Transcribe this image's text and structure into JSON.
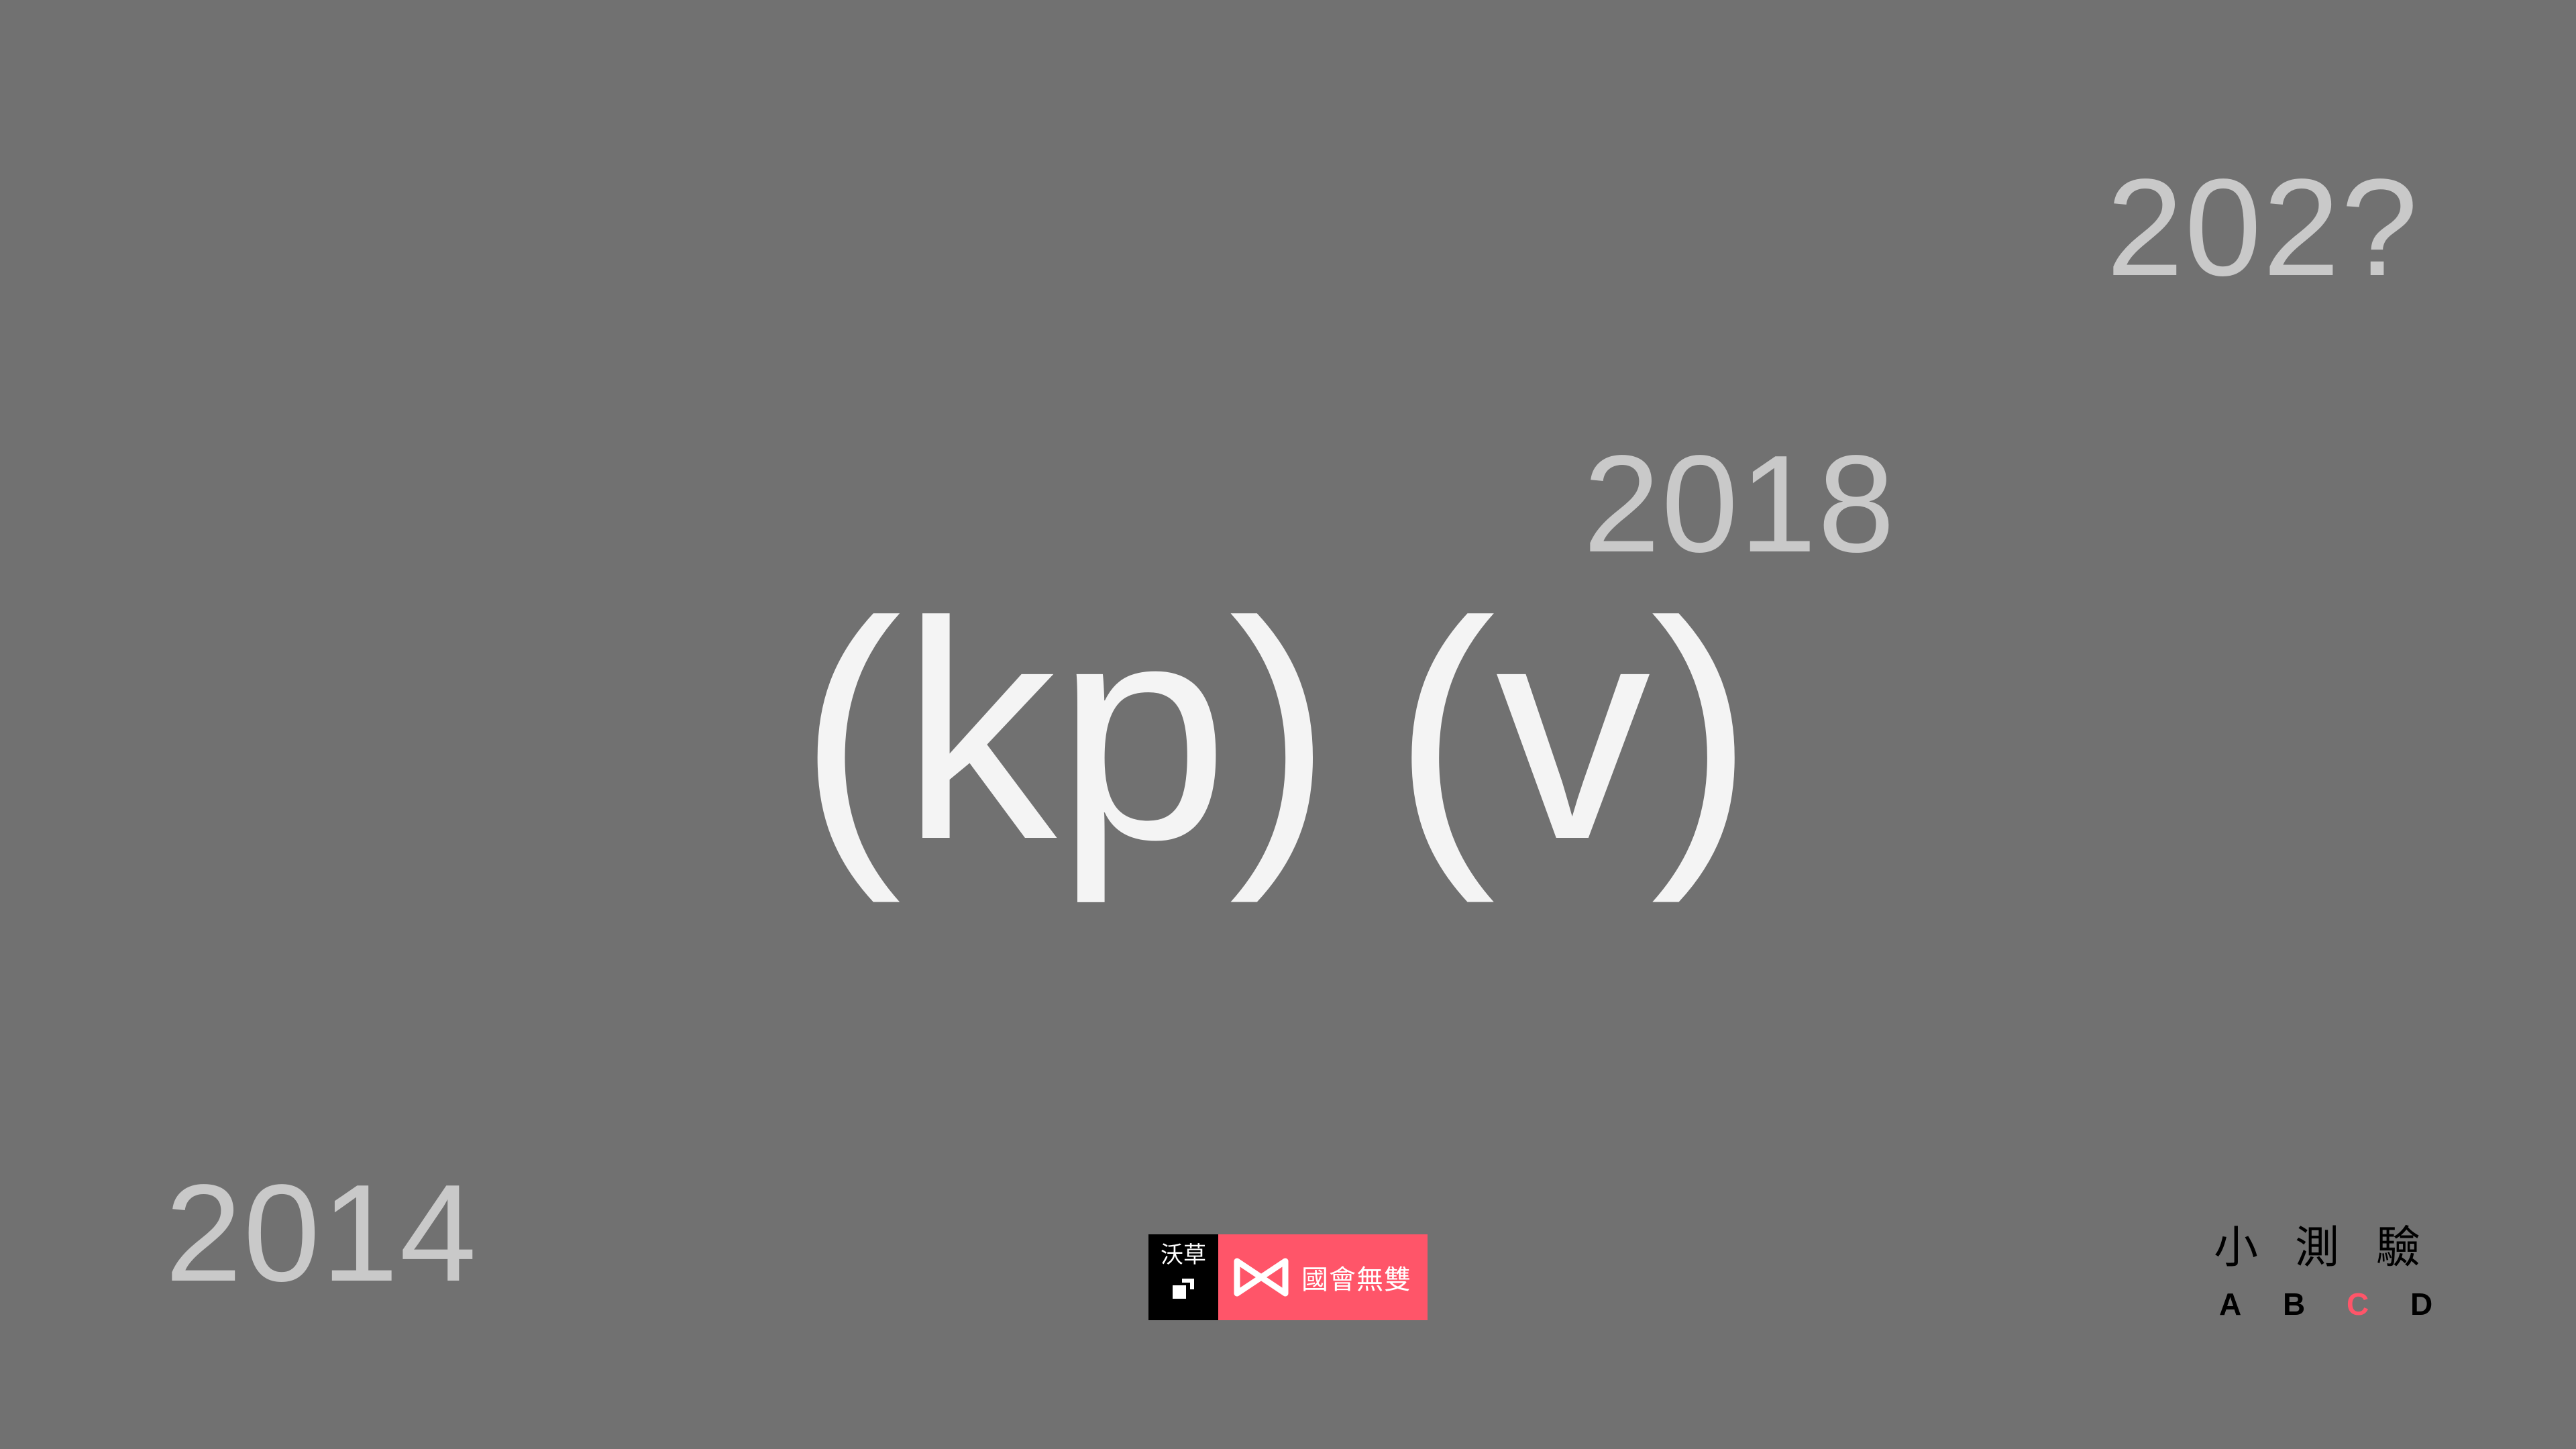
{
  "years": {
    "future": "202?",
    "mid": "2018",
    "past": "2014"
  },
  "formula": {
    "group1_open": "(",
    "group1_text": "kp",
    "group1_close": ")",
    "group2_open": "(",
    "group2_text": "v",
    "group2_close": ")"
  },
  "logo": {
    "left_text": "沃草",
    "right_text": "國會無雙"
  },
  "quiz": {
    "title_chars": [
      "小",
      "測",
      "驗"
    ],
    "options": [
      "A",
      "B",
      "C",
      "D"
    ],
    "selected": "C"
  },
  "colors": {
    "background": "#717171",
    "accent": "#ff5569",
    "year_text": "#c9c9c9",
    "formula_text": "#f4f4f4"
  }
}
